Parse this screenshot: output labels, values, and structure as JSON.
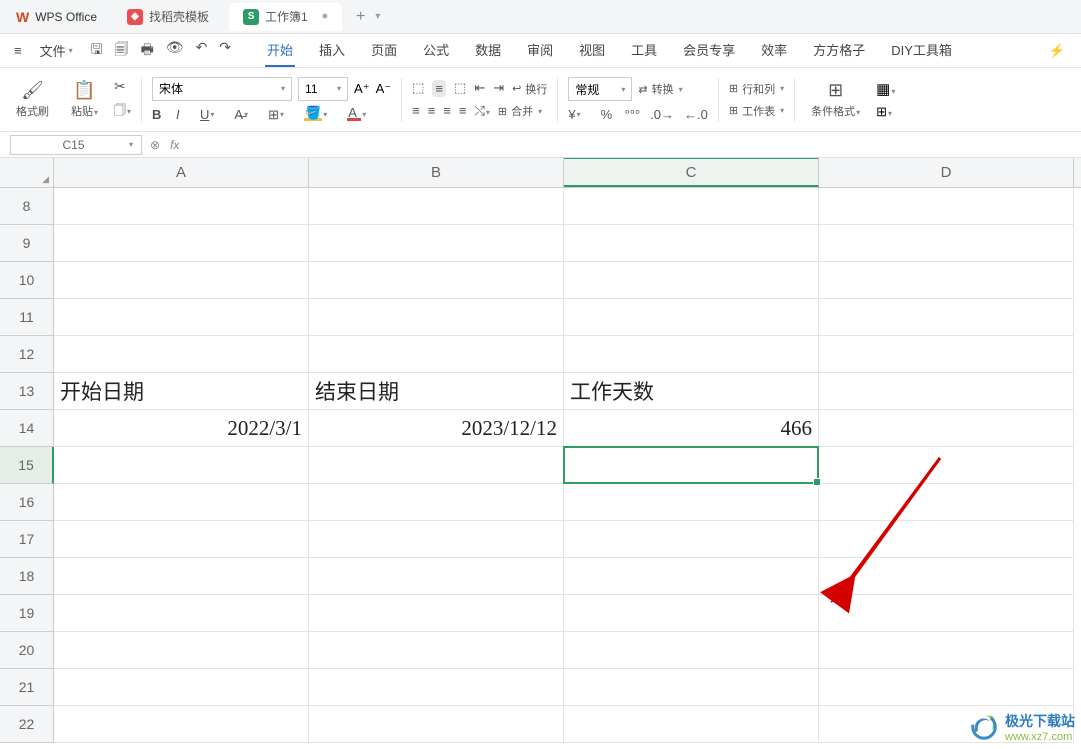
{
  "app": {
    "name": "WPS Office"
  },
  "tabs": [
    {
      "icon": "red",
      "label": "找稻壳模板"
    },
    {
      "icon": "green",
      "label": "工作簿1"
    }
  ],
  "file_menu": "文件",
  "menu": {
    "items": [
      "开始",
      "插入",
      "页面",
      "公式",
      "数据",
      "审阅",
      "视图",
      "工具",
      "会员专享",
      "效率",
      "方方格子",
      "DIY工具箱"
    ],
    "active": 0
  },
  "ribbon": {
    "format_painter": "格式刷",
    "paste": "粘贴",
    "font_name": "宋体",
    "font_size": "11",
    "wrap": "换行",
    "merge": "合并",
    "num_format": "常规",
    "convert": "转换",
    "rowcol": "行和列",
    "worksheet": "工作表",
    "cond_format": "条件格式"
  },
  "namebox": "C15",
  "columns": [
    "A",
    "B",
    "C",
    "D"
  ],
  "row_start": 8,
  "row_end": 22,
  "cells": {
    "A13": "开始日期",
    "B13": "结束日期",
    "C13": "工作天数",
    "A14": "2022/3/1",
    "B14": "2023/12/12",
    "C14": "466"
  },
  "watermark": {
    "line1": "极光下载站",
    "line2": "www.xz7.com"
  }
}
